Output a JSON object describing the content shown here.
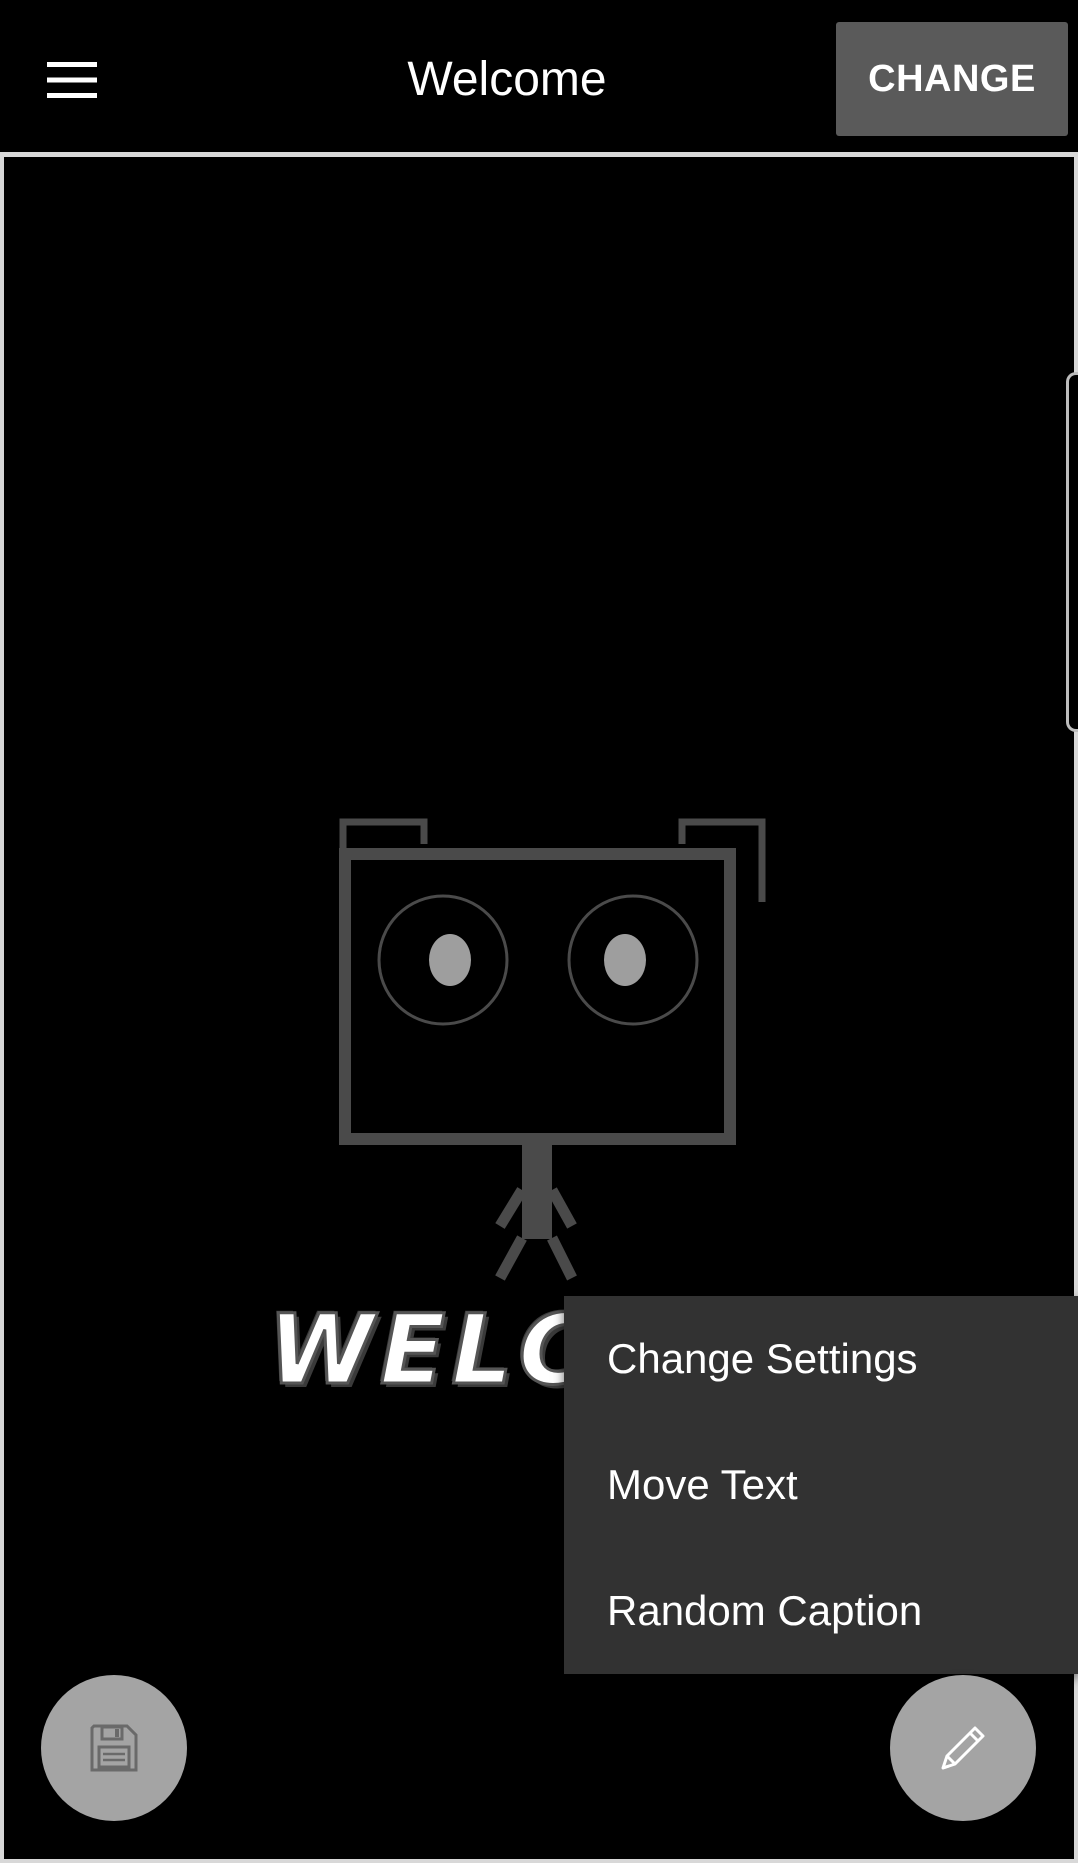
{
  "topbar": {
    "menu_icon": "hamburger-menu-icon",
    "title": "Welcome",
    "change_label": "CHANGE"
  },
  "canvas": {
    "logo_icon": "robot-logo-icon",
    "welcome_text": "WELC"
  },
  "popup_menu": {
    "items": [
      {
        "label": "Change Settings"
      },
      {
        "label": "Move Text"
      },
      {
        "label": "Random Caption"
      }
    ]
  },
  "fabs": {
    "save_icon": "floppy-disk-icon",
    "edit_icon": "pencil-icon"
  },
  "colors": {
    "background": "#000000",
    "button": "#5a5a5a",
    "menu": "#323232",
    "fab": "#a4a4a4"
  }
}
